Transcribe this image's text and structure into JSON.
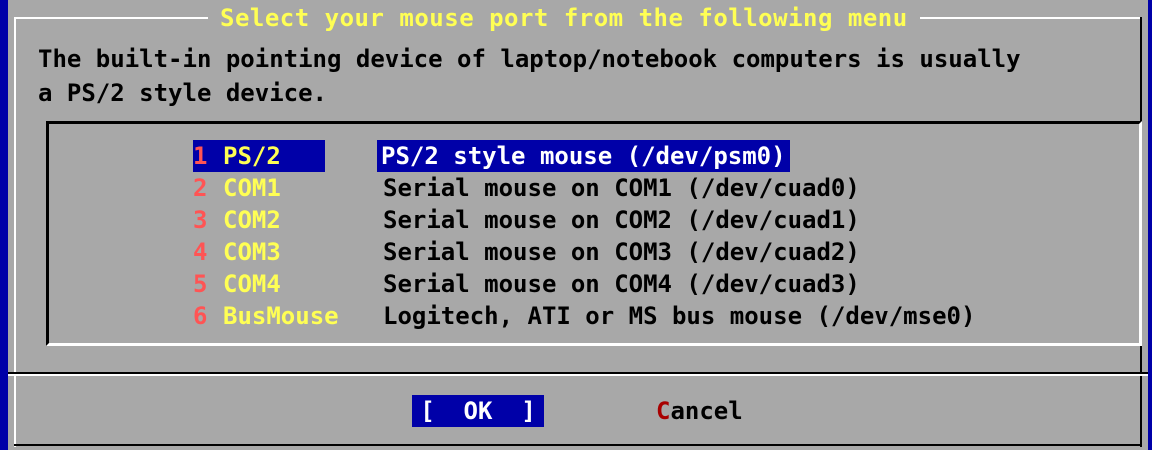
{
  "dialog": {
    "title": "Select your mouse port from the following menu",
    "prompt": "The built-in pointing device of laptop/notebook computers is usually\na PS/2 style device."
  },
  "menu": {
    "items": [
      {
        "num": "1",
        "tag": "PS/2",
        "desc": "PS/2 style mouse (/dev/psm0)",
        "selected": true
      },
      {
        "num": "2",
        "tag": "COM1",
        "desc": "Serial mouse on COM1 (/dev/cuad0)"
      },
      {
        "num": "3",
        "tag": "COM2",
        "desc": "Serial mouse on COM2 (/dev/cuad1)"
      },
      {
        "num": "4",
        "tag": "COM3",
        "desc": "Serial mouse on COM3 (/dev/cuad2)"
      },
      {
        "num": "5",
        "tag": "COM4",
        "desc": "Serial mouse on COM4 (/dev/cuad3)"
      },
      {
        "num": "6",
        "tag": "BusMouse",
        "desc": "Logitech, ATI or MS bus mouse (/dev/mse0)"
      }
    ]
  },
  "buttons": {
    "ok_label": "[  OK  ]",
    "cancel_hotkey": "C",
    "cancel_rest": "ancel"
  },
  "colors": {
    "screen": "#0000a8",
    "dialog": "#a8a8a8",
    "title": "#ffff54",
    "hotkey_number": "#ff5454",
    "tag": "#ffff54",
    "selection": "#0000a8"
  }
}
